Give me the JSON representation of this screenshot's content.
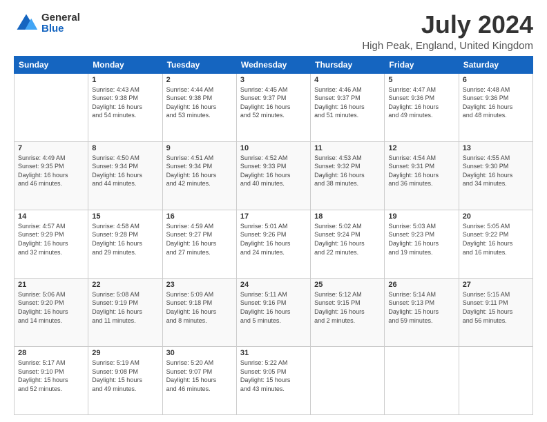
{
  "logo": {
    "general": "General",
    "blue": "Blue"
  },
  "header": {
    "title": "July 2024",
    "subtitle": "High Peak, England, United Kingdom"
  },
  "days_of_week": [
    "Sunday",
    "Monday",
    "Tuesday",
    "Wednesday",
    "Thursday",
    "Friday",
    "Saturday"
  ],
  "weeks": [
    [
      {
        "day": "",
        "info": ""
      },
      {
        "day": "1",
        "info": "Sunrise: 4:43 AM\nSunset: 9:38 PM\nDaylight: 16 hours\nand 54 minutes."
      },
      {
        "day": "2",
        "info": "Sunrise: 4:44 AM\nSunset: 9:38 PM\nDaylight: 16 hours\nand 53 minutes."
      },
      {
        "day": "3",
        "info": "Sunrise: 4:45 AM\nSunset: 9:37 PM\nDaylight: 16 hours\nand 52 minutes."
      },
      {
        "day": "4",
        "info": "Sunrise: 4:46 AM\nSunset: 9:37 PM\nDaylight: 16 hours\nand 51 minutes."
      },
      {
        "day": "5",
        "info": "Sunrise: 4:47 AM\nSunset: 9:36 PM\nDaylight: 16 hours\nand 49 minutes."
      },
      {
        "day": "6",
        "info": "Sunrise: 4:48 AM\nSunset: 9:36 PM\nDaylight: 16 hours\nand 48 minutes."
      }
    ],
    [
      {
        "day": "7",
        "info": "Sunrise: 4:49 AM\nSunset: 9:35 PM\nDaylight: 16 hours\nand 46 minutes."
      },
      {
        "day": "8",
        "info": "Sunrise: 4:50 AM\nSunset: 9:34 PM\nDaylight: 16 hours\nand 44 minutes."
      },
      {
        "day": "9",
        "info": "Sunrise: 4:51 AM\nSunset: 9:34 PM\nDaylight: 16 hours\nand 42 minutes."
      },
      {
        "day": "10",
        "info": "Sunrise: 4:52 AM\nSunset: 9:33 PM\nDaylight: 16 hours\nand 40 minutes."
      },
      {
        "day": "11",
        "info": "Sunrise: 4:53 AM\nSunset: 9:32 PM\nDaylight: 16 hours\nand 38 minutes."
      },
      {
        "day": "12",
        "info": "Sunrise: 4:54 AM\nSunset: 9:31 PM\nDaylight: 16 hours\nand 36 minutes."
      },
      {
        "day": "13",
        "info": "Sunrise: 4:55 AM\nSunset: 9:30 PM\nDaylight: 16 hours\nand 34 minutes."
      }
    ],
    [
      {
        "day": "14",
        "info": "Sunrise: 4:57 AM\nSunset: 9:29 PM\nDaylight: 16 hours\nand 32 minutes."
      },
      {
        "day": "15",
        "info": "Sunrise: 4:58 AM\nSunset: 9:28 PM\nDaylight: 16 hours\nand 29 minutes."
      },
      {
        "day": "16",
        "info": "Sunrise: 4:59 AM\nSunset: 9:27 PM\nDaylight: 16 hours\nand 27 minutes."
      },
      {
        "day": "17",
        "info": "Sunrise: 5:01 AM\nSunset: 9:26 PM\nDaylight: 16 hours\nand 24 minutes."
      },
      {
        "day": "18",
        "info": "Sunrise: 5:02 AM\nSunset: 9:24 PM\nDaylight: 16 hours\nand 22 minutes."
      },
      {
        "day": "19",
        "info": "Sunrise: 5:03 AM\nSunset: 9:23 PM\nDaylight: 16 hours\nand 19 minutes."
      },
      {
        "day": "20",
        "info": "Sunrise: 5:05 AM\nSunset: 9:22 PM\nDaylight: 16 hours\nand 16 minutes."
      }
    ],
    [
      {
        "day": "21",
        "info": "Sunrise: 5:06 AM\nSunset: 9:20 PM\nDaylight: 16 hours\nand 14 minutes."
      },
      {
        "day": "22",
        "info": "Sunrise: 5:08 AM\nSunset: 9:19 PM\nDaylight: 16 hours\nand 11 minutes."
      },
      {
        "day": "23",
        "info": "Sunrise: 5:09 AM\nSunset: 9:18 PM\nDaylight: 16 hours\nand 8 minutes."
      },
      {
        "day": "24",
        "info": "Sunrise: 5:11 AM\nSunset: 9:16 PM\nDaylight: 16 hours\nand 5 minutes."
      },
      {
        "day": "25",
        "info": "Sunrise: 5:12 AM\nSunset: 9:15 PM\nDaylight: 16 hours\nand 2 minutes."
      },
      {
        "day": "26",
        "info": "Sunrise: 5:14 AM\nSunset: 9:13 PM\nDaylight: 15 hours\nand 59 minutes."
      },
      {
        "day": "27",
        "info": "Sunrise: 5:15 AM\nSunset: 9:11 PM\nDaylight: 15 hours\nand 56 minutes."
      }
    ],
    [
      {
        "day": "28",
        "info": "Sunrise: 5:17 AM\nSunset: 9:10 PM\nDaylight: 15 hours\nand 52 minutes."
      },
      {
        "day": "29",
        "info": "Sunrise: 5:19 AM\nSunset: 9:08 PM\nDaylight: 15 hours\nand 49 minutes."
      },
      {
        "day": "30",
        "info": "Sunrise: 5:20 AM\nSunset: 9:07 PM\nDaylight: 15 hours\nand 46 minutes."
      },
      {
        "day": "31",
        "info": "Sunrise: 5:22 AM\nSunset: 9:05 PM\nDaylight: 15 hours\nand 43 minutes."
      },
      {
        "day": "",
        "info": ""
      },
      {
        "day": "",
        "info": ""
      },
      {
        "day": "",
        "info": ""
      }
    ]
  ]
}
